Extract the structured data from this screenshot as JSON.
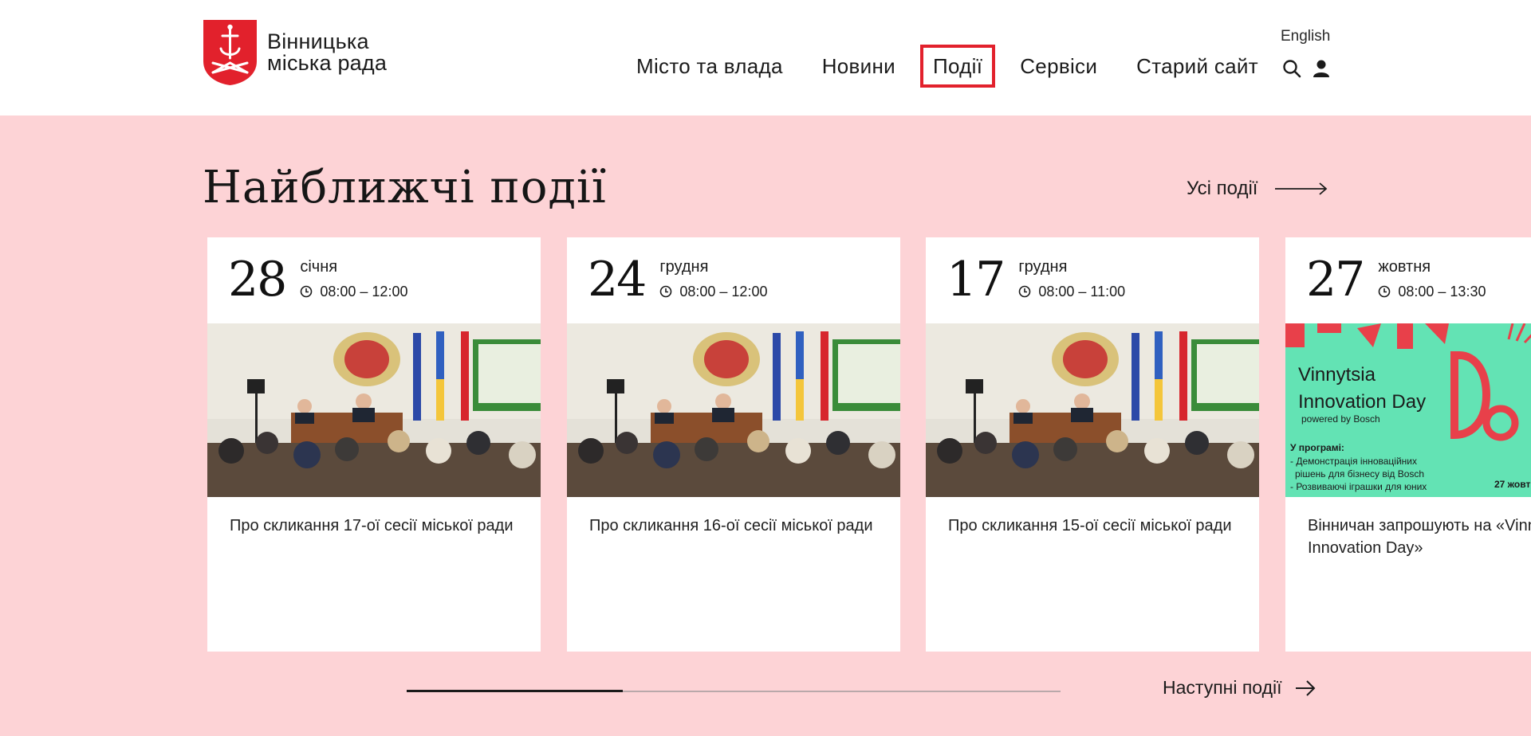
{
  "header": {
    "logo_line1": "Вінницька",
    "logo_line2": "міська рада",
    "language": "English",
    "nav": [
      {
        "label": "Місто та влада"
      },
      {
        "label": "Новини"
      },
      {
        "label": "Події",
        "active": true
      },
      {
        "label": "Сервіси"
      },
      {
        "label": "Старий сайт"
      }
    ]
  },
  "events": {
    "title": "Найближчі події",
    "all_link": "Усі події",
    "next_link": "Наступні події",
    "progress": 0.33,
    "cards": [
      {
        "day": "28",
        "month": "січня",
        "time": "08:00 – 12:00",
        "title": "Про скликання 17-ої сесії міської ради",
        "image": "council-session-photo"
      },
      {
        "day": "24",
        "month": "грудня",
        "time": "08:00 – 12:00",
        "title": "Про скликання 16-ої сесії міської ради",
        "image": "council-session-photo"
      },
      {
        "day": "17",
        "month": "грудня",
        "time": "08:00 – 11:00",
        "title": "Про скликання 15-ої сесії міської ради",
        "image": "council-session-photo"
      },
      {
        "day": "27",
        "month": "жовтня",
        "time": "08:00 – 13:30",
        "title": "Вінничан запрошують на «Vinnytsia Innovation Day»",
        "image": "innovation-day-poster"
      }
    ],
    "poster": {
      "line1": "Vinnytsia",
      "line2": "Innovation Day",
      "powered": "powered by Bosch",
      "program_title": "У програмі:",
      "program_1": "- Демонстрація інноваційних",
      "program_2": "рішень для бізнесу від Bosch",
      "program_3": "- Розвиваючі іграшки для юних",
      "date": "27 жовт"
    }
  },
  "colors": {
    "accent": "#e2212c",
    "section_bg": "#fdd3d6",
    "poster_bg": "#63e3b4"
  }
}
